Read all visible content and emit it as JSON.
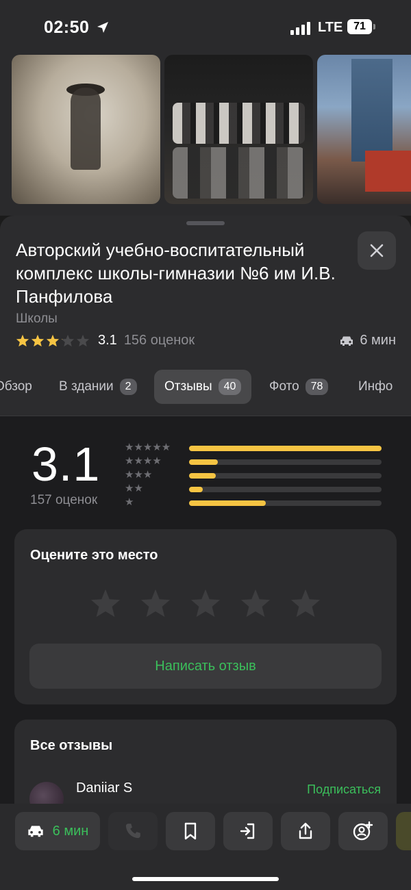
{
  "status_bar": {
    "time": "02:50",
    "network": "LTE",
    "battery": "71"
  },
  "place": {
    "title": "Авторский учебно-воспитательный комплекс школы-гимназии №6 им И.В. Панфилова",
    "category": "Школы",
    "rating": "3.1",
    "rating_stars_filled": 3.1,
    "rating_count": "156 оценок",
    "drive_time": "6 мин"
  },
  "tabs": [
    {
      "label": "Обзор"
    },
    {
      "label": "В здании",
      "badge": "2"
    },
    {
      "label": "Отзывы",
      "badge": "40",
      "active": true
    },
    {
      "label": "Фото",
      "badge": "78"
    },
    {
      "label": "Инфо"
    }
  ],
  "summary": {
    "rating": "3.1",
    "count": "157 оценок",
    "distribution": [
      {
        "stars": 5,
        "glyph": "★★★★★",
        "fraction": 1.0
      },
      {
        "stars": 4,
        "glyph": "★★★★",
        "fraction": 0.15
      },
      {
        "stars": 3,
        "glyph": "★★★",
        "fraction": 0.14
      },
      {
        "stars": 2,
        "glyph": "★★",
        "fraction": 0.07
      },
      {
        "stars": 1,
        "glyph": "★",
        "fraction": 0.4
      }
    ]
  },
  "rate_card": {
    "title": "Оцените это место",
    "write_button": "Написать отзыв"
  },
  "reviews_card": {
    "title": "Все отзывы",
    "first_reviewer": "Daniiar S",
    "subscribe_label": "Подписаться"
  },
  "action_bar": {
    "route_label": "6 мин"
  },
  "colors": {
    "accent_green": "#3bbf5b",
    "star_yellow": "#f6c443"
  }
}
